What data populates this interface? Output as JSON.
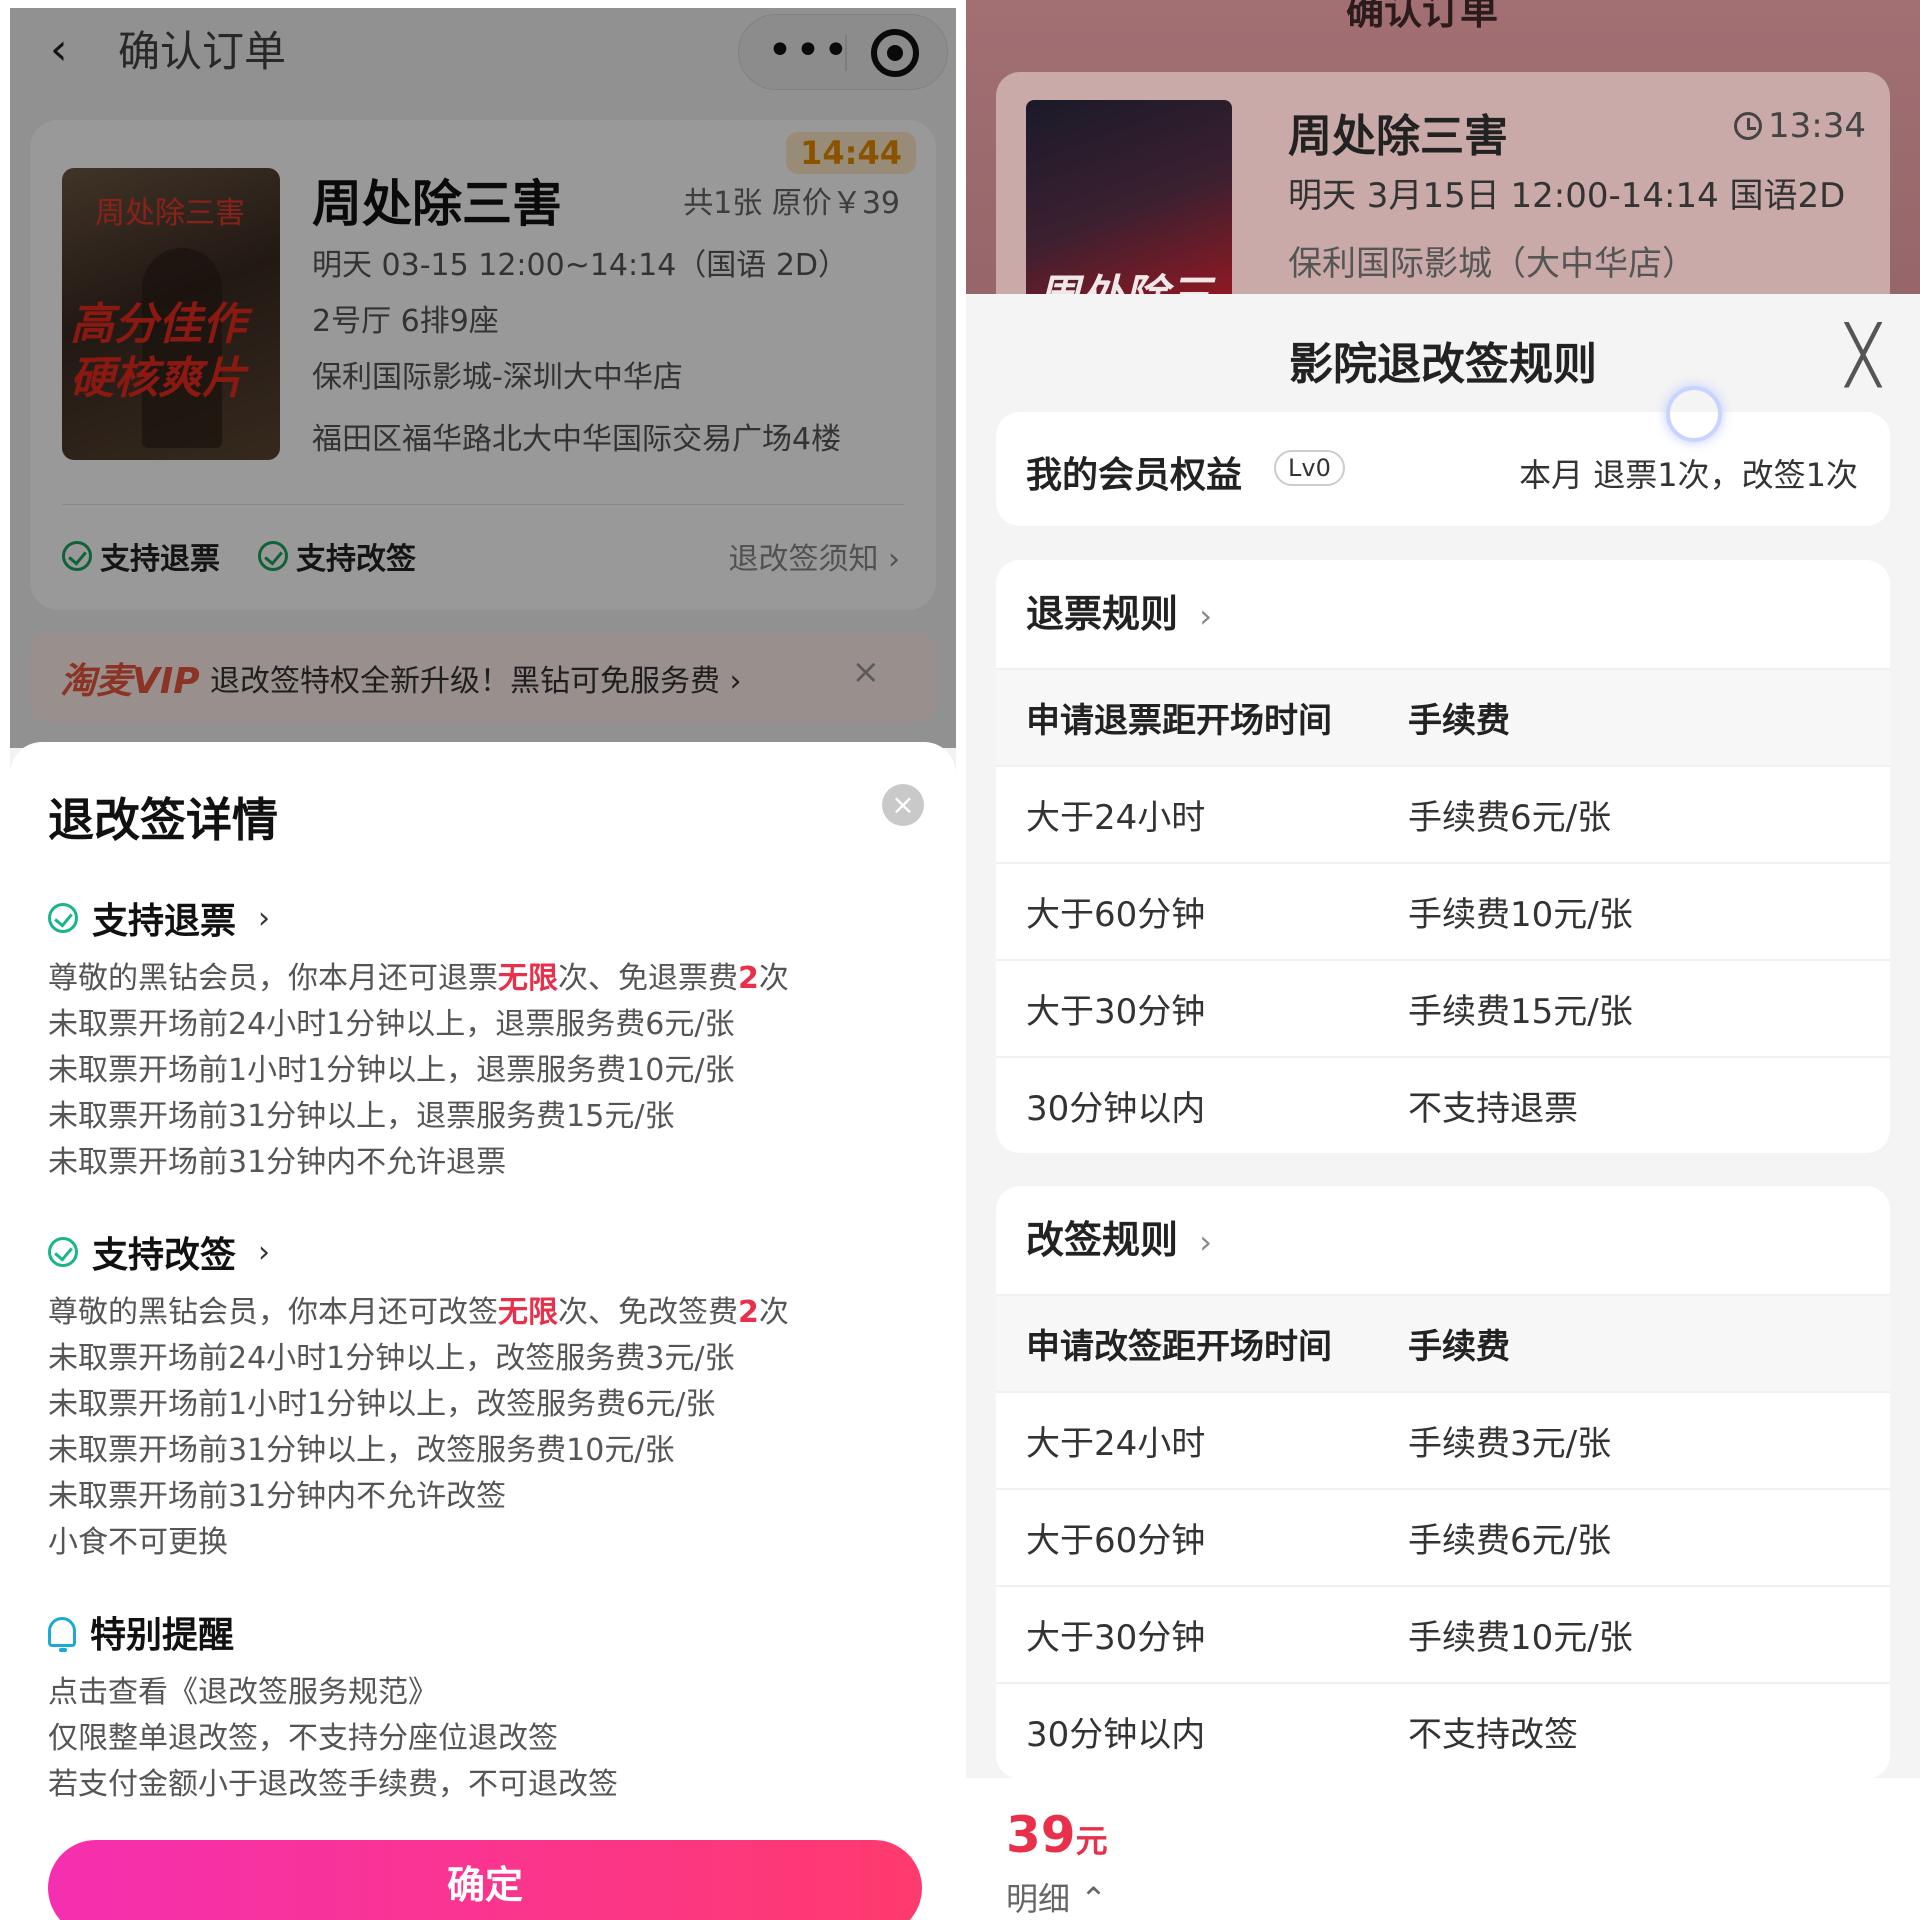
{
  "left": {
    "nav": {
      "back_icon": "‹",
      "title": "确认订单",
      "more_icon": "•••"
    },
    "order": {
      "timer": "14:44",
      "movie_name": "周处除三害",
      "ticket_price": "共1张 原价￥39",
      "show_time": "明天 03-15 12:00~14:14（国语 2D）",
      "hall_seat": "2号厅 6排9座",
      "cinema": "保利国际影城-深圳大中华店",
      "address": "福田区福华路北大中华国际交易广场4楼",
      "poster_title": "周处除三害",
      "poster_tagline": "高分佳作\n硬核爽片",
      "support_refund": "支持退票",
      "support_change": "支持改签",
      "notice_link": "退改签须知 ›"
    },
    "vip": {
      "logo": "淘麦VIP",
      "text": "退改签特权全新升级！黑钻可免服务费 ›",
      "close": "×"
    },
    "sheet": {
      "title": "退改签详情",
      "close": "×",
      "refund_head": "支持退票",
      "refund_intro_a": "尊敬的黑钻会员，你本月还可退票",
      "refund_intro_red": "无限",
      "refund_intro_b": "次、免退票费",
      "refund_intro_num": "2",
      "refund_intro_c": "次",
      "refund_lines": [
        "未取票开场前24小时1分钟以上，退票服务费6元/张",
        "未取票开场前1小时1分钟以上，退票服务费10元/张",
        "未取票开场前31分钟以上，退票服务费15元/张",
        "未取票开场前31分钟内不允许退票"
      ],
      "change_head": "支持改签",
      "change_intro_a": "尊敬的黑钻会员，你本月还可改签",
      "change_intro_red": "无限",
      "change_intro_b": "次、免改签费",
      "change_intro_num": "2",
      "change_intro_c": "次",
      "change_lines": [
        "未取票开场前24小时1分钟以上，改签服务费3元/张",
        "未取票开场前1小时1分钟以上，改签服务费6元/张",
        "未取票开场前31分钟以上，改签服务费10元/张",
        "未取票开场前31分钟内不允许改签",
        "小食不可更换"
      ],
      "reminder_head": "特别提醒",
      "reminder_lines": [
        "点击查看《退改签服务规范》",
        "仅限整单退改签，不支持分座位退改签",
        "若支付金额小于退改签手续费，不可退改签"
      ],
      "confirm": "确定"
    }
  },
  "right": {
    "nav_title": "确认订单",
    "card": {
      "movie_name": "周处除三害",
      "timer": "13:34",
      "show_time": "明天 3月15日 12:00-14:14 国语2D",
      "cinema": "保利国际影城（大中华店）",
      "poster_text": "周处除三害"
    },
    "sheet": {
      "title": "影院退改签规则",
      "close": "╳",
      "member_label": "我的会员权益",
      "member_level": "Lv0",
      "member_value": "本月 退票1次，改签1次",
      "refund": {
        "title": "退票规则",
        "head": [
          "申请退票距开场时间",
          "手续费"
        ],
        "rows": [
          [
            "大于24小时",
            "手续费6元/张"
          ],
          [
            "大于60分钟",
            "手续费10元/张"
          ],
          [
            "大于30分钟",
            "手续费15元/张"
          ],
          [
            "30分钟以内",
            "不支持退票"
          ]
        ]
      },
      "change": {
        "title": "改签规则",
        "head": [
          "申请改签距开场时间",
          "手续费"
        ],
        "rows": [
          [
            "大于24小时",
            "手续费3元/张"
          ],
          [
            "大于60分钟",
            "手续费6元/张"
          ],
          [
            "大于30分钟",
            "手续费10元/张"
          ],
          [
            "30分钟以内",
            "不支持改签"
          ]
        ]
      }
    },
    "bottom": {
      "price": "39",
      "unit": "元",
      "detail": "明细 ⌃"
    }
  },
  "colors": {
    "accent_red": "#e8304a",
    "confirm_gradient_start": "#f52fb0",
    "confirm_gradient_end": "#ff3a6e",
    "check_green": "#19b58a"
  }
}
